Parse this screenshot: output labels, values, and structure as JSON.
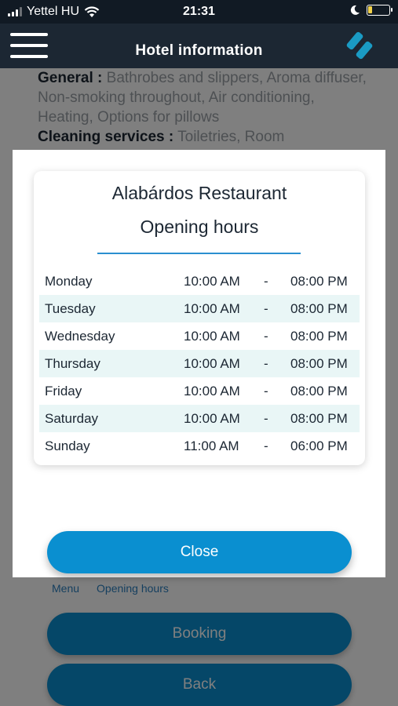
{
  "status_bar": {
    "carrier": "Yettel HU",
    "time": "21:31"
  },
  "header": {
    "title": "Hotel information"
  },
  "background": {
    "general_label": "General :",
    "general_text": "Bathrobes and slippers, Aroma diffuser, Non-smoking throughout, Air conditioning, Heating, Options for pillows",
    "cleaning_label": "Cleaning services :",
    "cleaning_text": "Toiletries, Room",
    "tabs": [
      "Menu",
      "Opening hours"
    ],
    "booking_label": "Booking",
    "back_label": "Back"
  },
  "modal": {
    "title": "Alabárdos Restaurant",
    "subtitle": "Opening hours",
    "hours": [
      {
        "day": "Monday",
        "open": "10:00 AM",
        "sep": "-",
        "close": "08:00 PM"
      },
      {
        "day": "Tuesday",
        "open": "10:00 AM",
        "sep": "-",
        "close": "08:00 PM"
      },
      {
        "day": "Wednesday",
        "open": "10:00 AM",
        "sep": "-",
        "close": "08:00 PM"
      },
      {
        "day": "Thursday",
        "open": "10:00 AM",
        "sep": "-",
        "close": "08:00 PM"
      },
      {
        "day": "Friday",
        "open": "10:00 AM",
        "sep": "-",
        "close": "08:00 PM"
      },
      {
        "day": "Saturday",
        "open": "10:00 AM",
        "sep": "-",
        "close": "08:00 PM"
      },
      {
        "day": "Sunday",
        "open": "11:00 AM",
        "sep": "-",
        "close": "06:00 PM"
      }
    ],
    "close_label": "Close"
  },
  "colors": {
    "accent": "#0a8fd0",
    "header_bg": "#1c2733",
    "row_alt": "#e9f6f6"
  }
}
